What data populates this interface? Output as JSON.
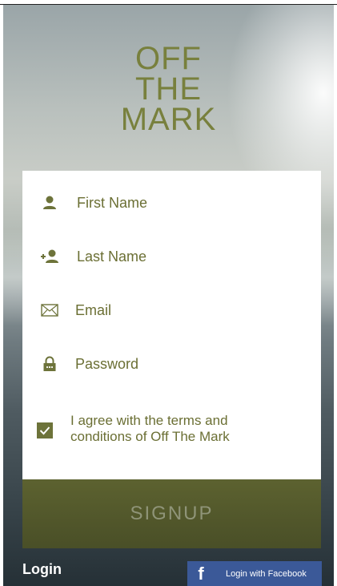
{
  "brand": {
    "line1": "OFF",
    "line2": "THE",
    "line3": "MARK"
  },
  "form": {
    "first_name": {
      "placeholder": "First Name",
      "icon": "user-icon"
    },
    "last_name": {
      "placeholder": "Last Name",
      "icon": "add-user-icon"
    },
    "email": {
      "placeholder": "Email",
      "icon": "envelope-icon"
    },
    "password": {
      "placeholder": "Password",
      "icon": "lock-icon"
    },
    "terms": {
      "text": "I agree with the terms and conditions of Off The Mark",
      "checked": true
    }
  },
  "actions": {
    "signup_label": "SIGNUP",
    "login_label": "Login",
    "facebook_label": "Login with Facebook"
  },
  "colors": {
    "accent": "#78803d",
    "facebook": "#3b5998"
  }
}
